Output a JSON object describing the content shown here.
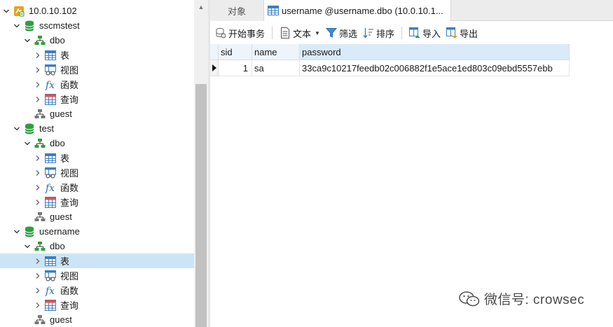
{
  "tree": [
    {
      "label": "10.0.10.102",
      "icon": "server-icon",
      "chev": "down"
    },
    {
      "label": "sscmstest",
      "icon": "database-icon",
      "chev": "down"
    },
    {
      "label": "dbo",
      "icon": "schema-icon",
      "chev": "down"
    },
    {
      "label": "表",
      "icon": "table-icon",
      "chev": "right"
    },
    {
      "label": "视图",
      "icon": "view-icon",
      "chev": "right"
    },
    {
      "label": "函数",
      "icon": "function-icon",
      "chev": "right"
    },
    {
      "label": "查询",
      "icon": "query-icon",
      "chev": "right"
    },
    {
      "label": "guest",
      "icon": "schema-gray-icon",
      "chev": "none"
    },
    {
      "label": "test",
      "icon": "database-icon",
      "chev": "down"
    },
    {
      "label": "dbo",
      "icon": "schema-icon",
      "chev": "down"
    },
    {
      "label": "表",
      "icon": "table-icon",
      "chev": "right"
    },
    {
      "label": "视图",
      "icon": "view-icon",
      "chev": "right"
    },
    {
      "label": "函数",
      "icon": "function-icon",
      "chev": "right"
    },
    {
      "label": "查询",
      "icon": "query-icon",
      "chev": "right"
    },
    {
      "label": "guest",
      "icon": "schema-gray-icon",
      "chev": "none"
    },
    {
      "label": "username",
      "icon": "database-icon",
      "chev": "down"
    },
    {
      "label": "dbo",
      "icon": "schema-icon",
      "chev": "down"
    },
    {
      "label": "表",
      "icon": "table-icon",
      "chev": "right",
      "selected": true
    },
    {
      "label": "视图",
      "icon": "view-icon",
      "chev": "right"
    },
    {
      "label": "函数",
      "icon": "function-icon",
      "chev": "right"
    },
    {
      "label": "查询",
      "icon": "query-icon",
      "chev": "right"
    },
    {
      "label": "guest",
      "icon": "schema-gray-icon",
      "chev": "none"
    }
  ],
  "tabs": {
    "objects": "对象",
    "active": "username @username.dbo (10.0.10.1..."
  },
  "toolbar": {
    "begin_transaction": "开始事务",
    "text": "文本",
    "filter": "筛选",
    "sort": "排序",
    "import": "导入",
    "export": "导出"
  },
  "grid": {
    "columns": [
      "sid",
      "name",
      "password"
    ],
    "rows": [
      {
        "sid": "1",
        "name": "sa",
        "password": "33ca9c10217feedb02c006882f1e5ace1ed803c09ebd5557ebb"
      }
    ]
  },
  "watermark": "微信号: crowsec",
  "colors": {
    "selection": "#cce4f7",
    "database": "#2e9e3e",
    "server": "#e8a317",
    "table": "#3b7fc4"
  }
}
